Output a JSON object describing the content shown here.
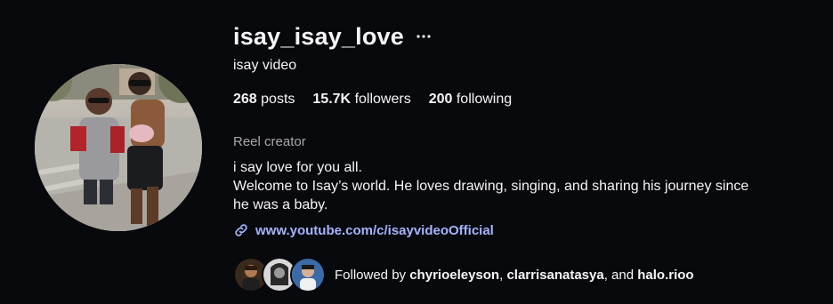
{
  "profile": {
    "username": "isay_isay_love",
    "more_icon": "more-horizontal-icon",
    "full_name": "isay video",
    "stats": {
      "posts_count": "268",
      "posts_label": "posts",
      "followers_count": "15.7K",
      "followers_label": "followers",
      "following_count": "200",
      "following_label": "following"
    },
    "category": "Reel creator",
    "bio_lines": [
      "i say love for you all.",
      "Welcome to Isay’s world. He loves drawing, singing, and sharing his journey since",
      "he was a baby."
    ],
    "link": {
      "icon": "link-icon",
      "text": "www.youtube.com/c/isayvideoOfficial"
    },
    "followed_by": {
      "prefix": "Followed by",
      "users": [
        "chyrioeleyson",
        "clarrisanatasya",
        "halo.rioo"
      ],
      "separator_1": ", ",
      "separator_2": ", and "
    }
  },
  "colors": {
    "background": "#08090d",
    "text": "#f5f5f5",
    "muted": "#a8a8a8",
    "link": "#a5b4fc"
  }
}
